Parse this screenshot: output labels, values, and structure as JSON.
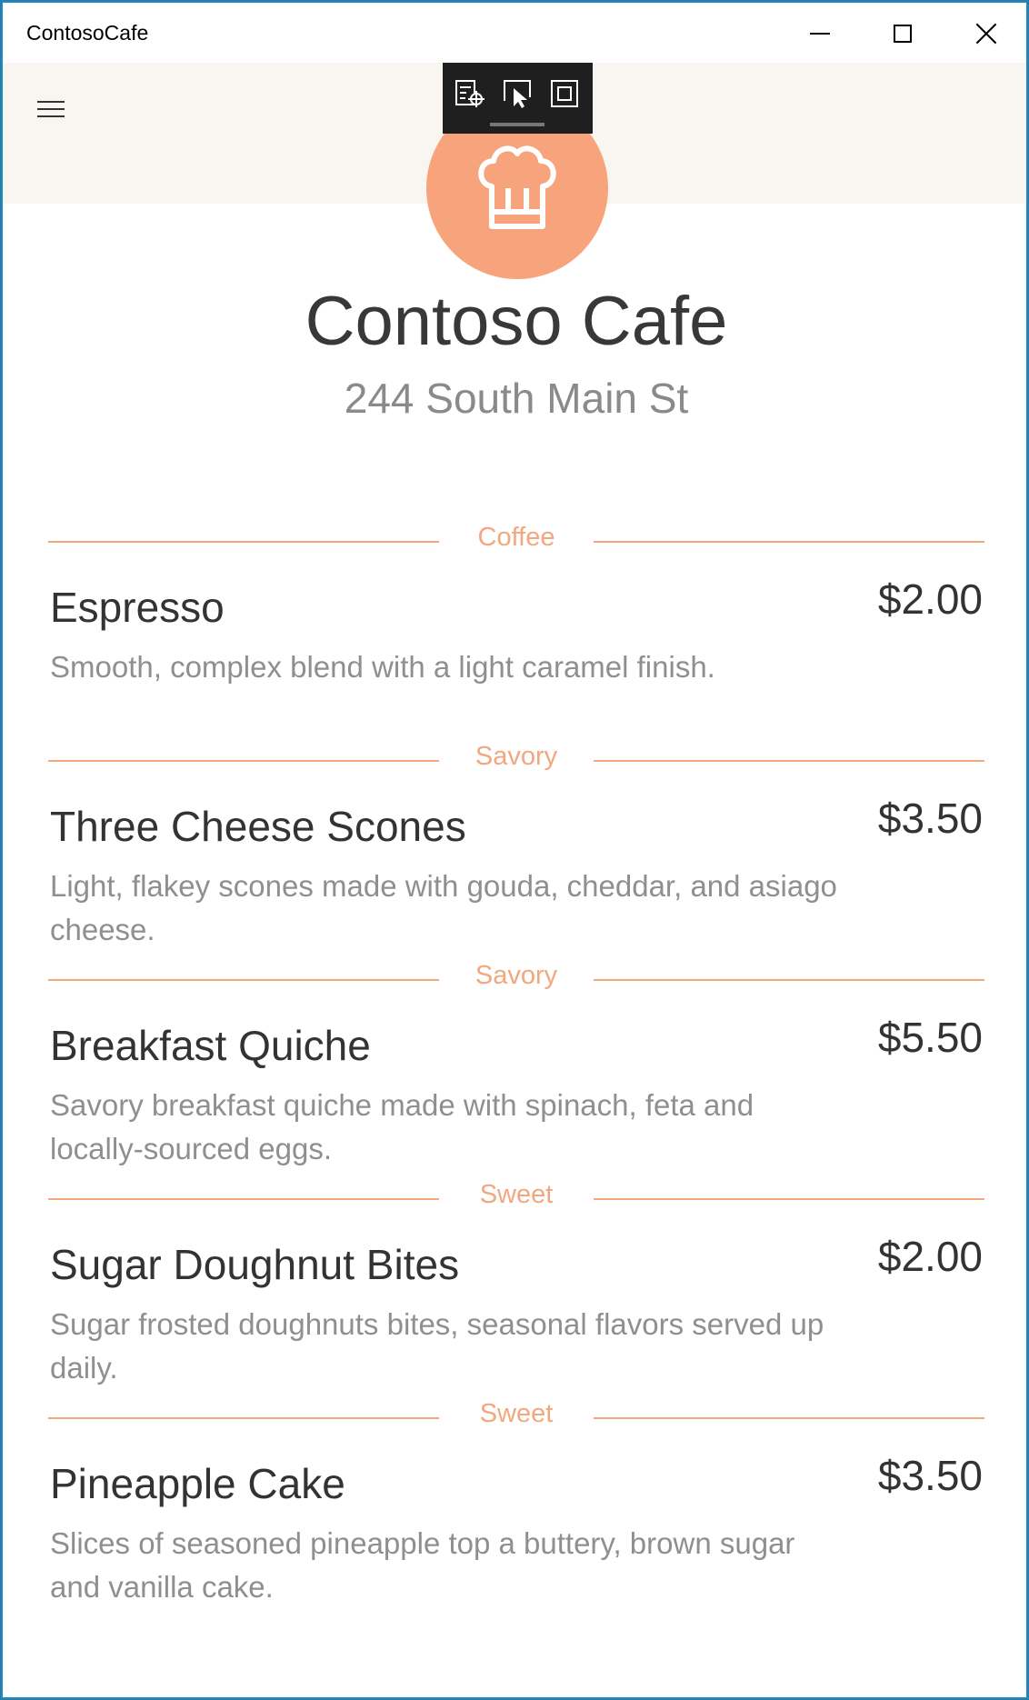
{
  "window": {
    "title": "ContosoCafe"
  },
  "header": {
    "menu_icon": "hamburger-icon",
    "logo_icon": "chef-hat-icon",
    "accent_color": "#f7a47c",
    "band_color": "#f9f6f1"
  },
  "debug_toolbar": {
    "buttons": [
      "live-visual-tree-icon",
      "select-element-icon",
      "display-layout-adorners-icon"
    ]
  },
  "cafe": {
    "name": "Contoso Cafe",
    "address": "244 South Main St"
  },
  "menu": {
    "items": [
      {
        "category": "Coffee",
        "name": "Espresso",
        "price": "$2.00",
        "description": "Smooth, complex blend with a light caramel finish."
      },
      {
        "category": "Savory",
        "name": "Three Cheese Scones",
        "price": "$3.50",
        "description": "Light, flakey scones made with gouda, cheddar, and asiago cheese."
      },
      {
        "category": "Savory",
        "name": "Breakfast Quiche",
        "price": "$5.50",
        "description": "Savory breakfast quiche made with spinach, feta and locally-sourced eggs."
      },
      {
        "category": "Sweet",
        "name": "Sugar Doughnut Bites",
        "price": "$2.00",
        "description": "Sugar frosted doughnuts bites, seasonal flavors served up daily."
      },
      {
        "category": "Sweet",
        "name": "Pineapple Cake",
        "price": "$3.50",
        "description": "Slices of seasoned pineapple top a buttery, brown sugar and vanilla cake."
      }
    ]
  }
}
